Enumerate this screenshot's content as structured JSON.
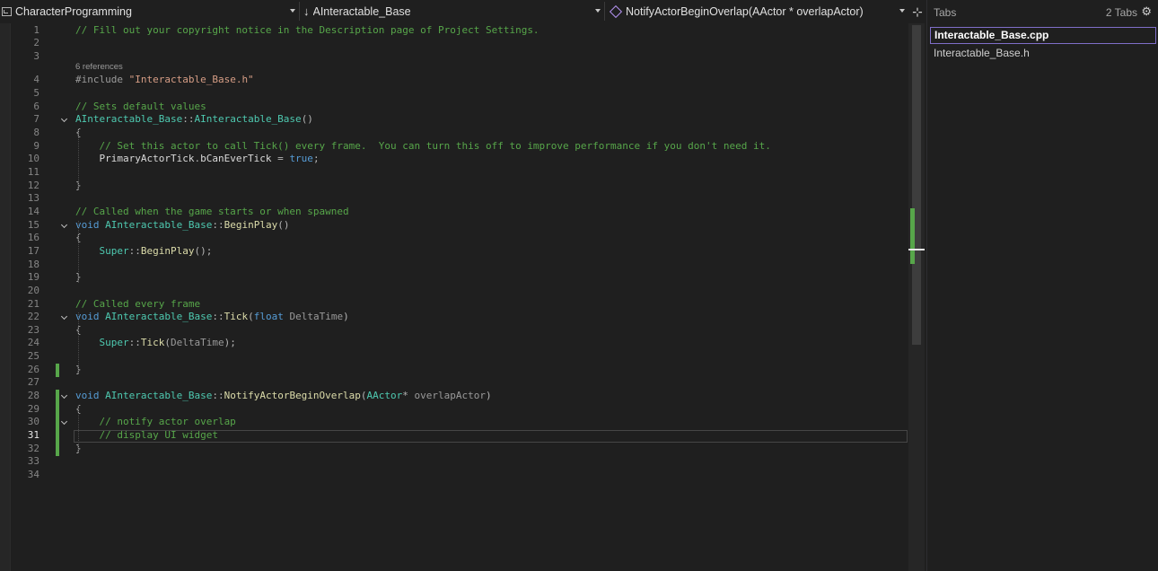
{
  "navbar": {
    "project": "CharacterProgramming",
    "scope": "AInteractable_Base",
    "member": "NotifyActorBeginOverlap(AActor * overlapActor)"
  },
  "tabs_panel": {
    "title": "Tabs",
    "count": "2 Tabs",
    "items": [
      {
        "label": "Interactable_Base.cpp"
      },
      {
        "label": "Interactable_Base.h"
      }
    ]
  },
  "editor": {
    "active_line": "31",
    "codelens": "6 references",
    "lines": [
      {
        "n": "1",
        "tokens": [
          {
            "t": "// Fill out your copyright notice in the Description page of Project Settings.",
            "c": "cm"
          }
        ]
      },
      {
        "n": "2",
        "tokens": []
      },
      {
        "n": "3",
        "tokens": []
      },
      {
        "n": "4",
        "tokens": [
          {
            "t": "#include ",
            "c": "pp"
          },
          {
            "t": "\"Interactable_Base.h\"",
            "c": "st"
          }
        ]
      },
      {
        "n": "5",
        "tokens": []
      },
      {
        "n": "6",
        "tokens": [
          {
            "t": "// Sets default values",
            "c": "cm"
          }
        ]
      },
      {
        "n": "7",
        "tokens": [
          {
            "t": "AInteractable_Base",
            "c": "ty"
          },
          {
            "t": "::",
            "c": "op"
          },
          {
            "t": "AInteractable_Base",
            "c": "ty"
          },
          {
            "t": "()",
            "c": "op"
          }
        ]
      },
      {
        "n": "8",
        "tokens": [
          {
            "t": "{",
            "c": "op"
          }
        ]
      },
      {
        "n": "9",
        "tokens": [
          {
            "t": "    // Set this actor to call Tick() every frame.  You can turn this off to improve performance if you don't need it.",
            "c": "cm"
          }
        ]
      },
      {
        "n": "10",
        "tokens": [
          {
            "t": "    PrimaryActorTick",
            "c": "mb"
          },
          {
            "t": ".",
            "c": "op"
          },
          {
            "t": "bCanEverTick",
            "c": "mb"
          },
          {
            "t": " = ",
            "c": "op"
          },
          {
            "t": "true",
            "c": "kw"
          },
          {
            "t": ";",
            "c": "op"
          }
        ]
      },
      {
        "n": "11",
        "tokens": []
      },
      {
        "n": "12",
        "tokens": [
          {
            "t": "}",
            "c": "op"
          }
        ]
      },
      {
        "n": "13",
        "tokens": []
      },
      {
        "n": "14",
        "tokens": [
          {
            "t": "// Called when the game starts or when spawned",
            "c": "cm"
          }
        ]
      },
      {
        "n": "15",
        "tokens": [
          {
            "t": "void ",
            "c": "kw"
          },
          {
            "t": "AInteractable_Base",
            "c": "ty"
          },
          {
            "t": "::",
            "c": "op"
          },
          {
            "t": "BeginPlay",
            "c": "fn"
          },
          {
            "t": "()",
            "c": "op"
          }
        ]
      },
      {
        "n": "16",
        "tokens": [
          {
            "t": "{",
            "c": "op"
          }
        ]
      },
      {
        "n": "17",
        "tokens": [
          {
            "t": "    Super",
            "c": "ty"
          },
          {
            "t": "::",
            "c": "op"
          },
          {
            "t": "BeginPlay",
            "c": "fn"
          },
          {
            "t": "();",
            "c": "op"
          }
        ]
      },
      {
        "n": "18",
        "tokens": []
      },
      {
        "n": "19",
        "tokens": [
          {
            "t": "}",
            "c": "op"
          }
        ]
      },
      {
        "n": "20",
        "tokens": []
      },
      {
        "n": "21",
        "tokens": [
          {
            "t": "// Called every frame",
            "c": "cm"
          }
        ]
      },
      {
        "n": "22",
        "tokens": [
          {
            "t": "void ",
            "c": "kw"
          },
          {
            "t": "AInteractable_Base",
            "c": "ty"
          },
          {
            "t": "::",
            "c": "op"
          },
          {
            "t": "Tick",
            "c": "fn"
          },
          {
            "t": "(",
            "c": "op"
          },
          {
            "t": "float ",
            "c": "kw"
          },
          {
            "t": "DeltaTime",
            "c": "pa"
          },
          {
            "t": ")",
            "c": "op"
          }
        ]
      },
      {
        "n": "23",
        "tokens": [
          {
            "t": "{",
            "c": "op"
          }
        ]
      },
      {
        "n": "24",
        "tokens": [
          {
            "t": "    Super",
            "c": "ty"
          },
          {
            "t": "::",
            "c": "op"
          },
          {
            "t": "Tick",
            "c": "fn"
          },
          {
            "t": "(",
            "c": "op"
          },
          {
            "t": "DeltaTime",
            "c": "pa"
          },
          {
            "t": ");",
            "c": "op"
          }
        ]
      },
      {
        "n": "25",
        "tokens": []
      },
      {
        "n": "26",
        "tokens": [
          {
            "t": "}",
            "c": "op"
          }
        ]
      },
      {
        "n": "27",
        "tokens": []
      },
      {
        "n": "28",
        "tokens": [
          {
            "t": "void ",
            "c": "kw"
          },
          {
            "t": "AInteractable_Base",
            "c": "ty"
          },
          {
            "t": "::",
            "c": "op"
          },
          {
            "t": "NotifyActorBeginOverlap",
            "c": "fn"
          },
          {
            "t": "(",
            "c": "op"
          },
          {
            "t": "AActor",
            "c": "ty"
          },
          {
            "t": "* ",
            "c": "op"
          },
          {
            "t": "overlapActor",
            "c": "pa"
          },
          {
            "t": ")",
            "c": "op"
          }
        ]
      },
      {
        "n": "29",
        "tokens": [
          {
            "t": "{",
            "c": "op"
          }
        ]
      },
      {
        "n": "30",
        "tokens": [
          {
            "t": "    // notify actor overlap",
            "c": "cm"
          }
        ]
      },
      {
        "n": "31",
        "tokens": [
          {
            "t": "    // display UI widget",
            "c": "cm"
          }
        ]
      },
      {
        "n": "32",
        "tokens": [
          {
            "t": "}",
            "c": "op"
          }
        ]
      },
      {
        "n": "33",
        "tokens": []
      },
      {
        "n": "34",
        "tokens": []
      }
    ]
  }
}
